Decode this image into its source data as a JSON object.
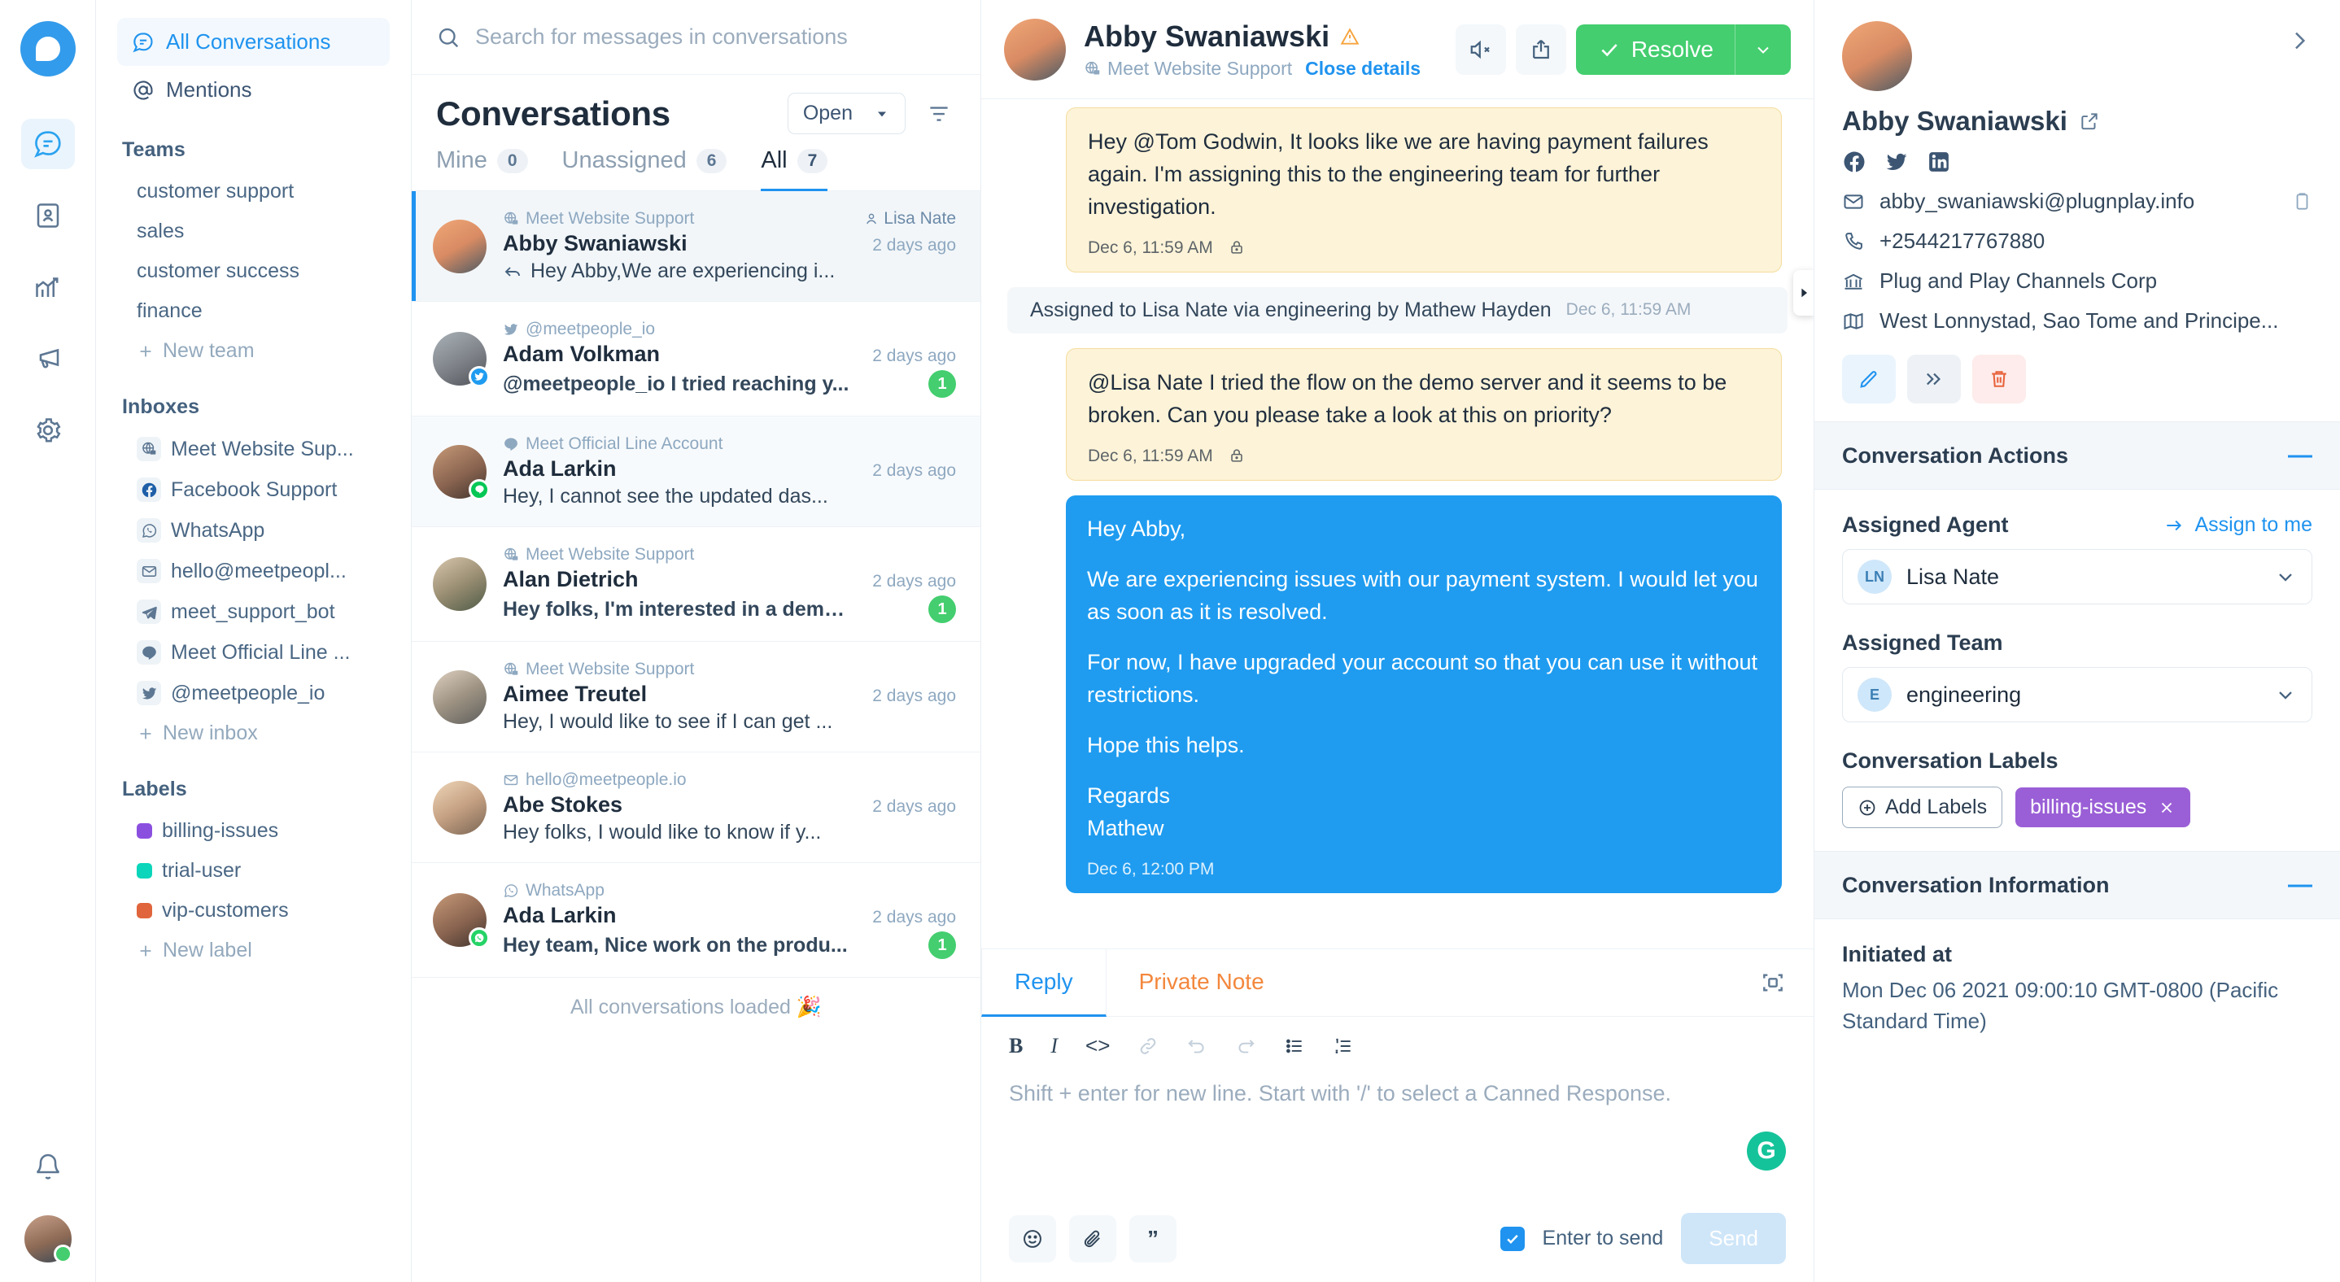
{
  "rail": {
    "logo_name": "chatwoot-logo",
    "items": [
      {
        "name": "conversations",
        "icon": "chat-icon",
        "active": true
      },
      {
        "name": "contacts",
        "icon": "contact-book-icon",
        "active": false
      },
      {
        "name": "reports",
        "icon": "chart-growth-icon",
        "active": false
      },
      {
        "name": "campaigns",
        "icon": "megaphone-icon",
        "active": false
      },
      {
        "name": "settings",
        "icon": "gear-icon",
        "active": false
      }
    ],
    "bottom": [
      {
        "name": "notifications",
        "icon": "bell-icon"
      },
      {
        "name": "profile-avatar",
        "icon": "avatar"
      }
    ]
  },
  "sidebar": {
    "primary": [
      {
        "label": "All Conversations",
        "icon": "chat-icon",
        "active": true
      },
      {
        "label": "Mentions",
        "icon": "at-icon",
        "active": false
      }
    ],
    "teams_heading": "Teams",
    "teams": [
      {
        "label": "customer support"
      },
      {
        "label": "sales"
      },
      {
        "label": "customer success"
      },
      {
        "label": "finance"
      }
    ],
    "new_team_label": "New team",
    "inboxes_heading": "Inboxes",
    "inboxes": [
      {
        "label": "Meet Website Sup...",
        "icon": "globe-website-icon",
        "color": "#5d7793"
      },
      {
        "label": "Facebook Support",
        "icon": "facebook-icon",
        "color": "#1f5fa8"
      },
      {
        "label": "WhatsApp",
        "icon": "whatsapp-icon",
        "color": "#3c5573"
      },
      {
        "label": "hello@meetpeopl...",
        "icon": "email-icon",
        "color": "#3c5573"
      },
      {
        "label": "meet_support_bot",
        "icon": "telegram-icon",
        "color": "#3c5573"
      },
      {
        "label": "Meet Official Line ...",
        "icon": "line-icon",
        "color": "#3c5573"
      },
      {
        "label": "@meetpeople_io",
        "icon": "twitter-icon",
        "color": "#3c5573"
      }
    ],
    "new_inbox_label": "New inbox",
    "labels_heading": "Labels",
    "labels": [
      {
        "label": "billing-issues",
        "color": "#8b4fe0"
      },
      {
        "label": "trial-user",
        "color": "#0bd5ba"
      },
      {
        "label": "vip-customers",
        "color": "#e0653c"
      }
    ],
    "new_label_label": "New label"
  },
  "search": {
    "placeholder": "Search for messages in conversations",
    "value": ""
  },
  "conversations_panel": {
    "title": "Conversations",
    "status_filter": "Open",
    "tabs": [
      {
        "label": "Mine",
        "count": "0",
        "active": false
      },
      {
        "label": "Unassigned",
        "count": "6",
        "active": false
      },
      {
        "label": "All",
        "count": "7",
        "active": true
      }
    ],
    "items": [
      {
        "source": "Meet Website Support",
        "source_icon": "globe-website-icon",
        "name": "Abby Swaniawski",
        "time": "2 days ago",
        "preview": "Hey Abby,We are experiencing i...",
        "preview_icon": "reply-arrow-icon",
        "assignee": "Lisa Nate",
        "unread": "",
        "active": true,
        "avatar_from": "#f0a878",
        "avatar_to": "#4a5a64",
        "channel_badge": ""
      },
      {
        "source": "@meetpeople_io",
        "source_icon": "twitter-icon",
        "name": "Adam Volkman",
        "time": "2 days ago",
        "preview": "@meetpeople_io I tried reaching y...",
        "preview_icon": "",
        "assignee": "",
        "unread": "1",
        "active": false,
        "avatar_from": "#9da6ad",
        "avatar_to": "#5c5f63",
        "channel_badge": "twitter"
      },
      {
        "source": "Meet Official Line Account",
        "source_icon": "line-icon",
        "name": "Ada Larkin",
        "time": "2 days ago",
        "preview": "Hey, I cannot see the updated das...",
        "preview_icon": "",
        "assignee": "",
        "unread": "",
        "active": false,
        "alt": true,
        "avatar_from": "#b98a6b",
        "avatar_to": "#4b3b33",
        "channel_badge": "line"
      },
      {
        "source": "Meet Website Support",
        "source_icon": "globe-website-icon",
        "name": "Alan Dietrich",
        "time": "2 days ago",
        "preview": "Hey folks, I'm interested in a demo...",
        "preview_icon": "",
        "assignee": "",
        "unread": "1",
        "active": false,
        "bold": true,
        "avatar_from": "#c9b9a4",
        "avatar_to": "#5d6b58",
        "channel_badge": ""
      },
      {
        "source": "Meet Website Support",
        "source_icon": "globe-website-icon",
        "name": "Aimee Treutel",
        "time": "2 days ago",
        "preview": "Hey, I would like to see if I can get ...",
        "preview_icon": "",
        "assignee": "",
        "unread": "",
        "active": false,
        "avatar_from": "#cdbba9",
        "avatar_to": "#6a6a68",
        "channel_badge": ""
      },
      {
        "source": "hello@meetpeople.io",
        "source_icon": "email-icon",
        "name": "Abe Stokes",
        "time": "2 days ago",
        "preview": "Hey folks, I would like to know if y...",
        "preview_icon": "",
        "assignee": "",
        "unread": "",
        "active": false,
        "avatar_from": "#e3c3a4",
        "avatar_to": "#7d6a58",
        "channel_badge": ""
      },
      {
        "source": "WhatsApp",
        "source_icon": "whatsapp-icon",
        "name": "Ada Larkin",
        "time": "2 days ago",
        "preview": "Hey team, Nice work on the produ...",
        "preview_icon": "",
        "assignee": "",
        "unread": "1",
        "active": false,
        "bold": true,
        "avatar_from": "#b98a6b",
        "avatar_to": "#4b3b33",
        "channel_badge": "whatsapp"
      }
    ],
    "footer": "All conversations loaded 🎉"
  },
  "conversation_header": {
    "name": "Abby Swaniawski",
    "warning_icon": "warning-triangle-icon",
    "inbox": "Meet Website Support",
    "close_details_label": "Close details",
    "mute_icon": "mute-speaker-icon",
    "share_icon": "share-icon",
    "resolve_label": "Resolve"
  },
  "thread": {
    "messages": [
      {
        "type": "note",
        "mention": "@Tom Godwin",
        "prefix": "Hey ",
        "text": ", It looks like we are having payment failures again. I'm assigning this to the engineering team for further investigation.",
        "time": "Dec 6, 11:59 AM",
        "lock_icon": "lock-icon"
      },
      {
        "type": "system",
        "text": "Assigned to Lisa Nate via engineering by Mathew Hayden",
        "time": "Dec 6, 11:59 AM"
      },
      {
        "type": "note",
        "mention": "@Lisa Nate",
        "prefix": "",
        "text": " I tried the flow on the demo server and it seems to be broken. Can you please take a look at this on priority?",
        "time": "Dec 6, 11:59 AM",
        "lock_icon": "lock-icon"
      },
      {
        "type": "outgoing",
        "paragraphs": [
          "Hey Abby,",
          "We are experiencing issues with our payment system. I would let you as soon as it is resolved.",
          "For now, I have upgraded your account so that you can use it without restrictions.",
          "Hope this helps.",
          "Regards",
          "Mathew"
        ],
        "time": "Dec 6, 12:00 PM"
      }
    ]
  },
  "editor": {
    "tabs": [
      {
        "label": "Reply",
        "active": true
      },
      {
        "label": "Private Note",
        "active": false
      }
    ],
    "expand_icon": "expand-icon",
    "toolbar": [
      {
        "name": "bold",
        "glyph": "B"
      },
      {
        "name": "italic",
        "glyph": "I"
      },
      {
        "name": "code",
        "glyph": "<>"
      },
      {
        "name": "link",
        "glyph": "🔗"
      },
      {
        "name": "undo",
        "glyph": "↩"
      },
      {
        "name": "redo",
        "glyph": "↪"
      },
      {
        "name": "bullet-list",
        "glyph": "☰"
      },
      {
        "name": "numbered-list",
        "glyph": "≣"
      }
    ],
    "placeholder": "Shift + enter for new line. Start with '/' to select a Canned Response.",
    "grammarly_glyph": "G",
    "emoji_icon": "emoji-icon",
    "attachment_icon": "paperclip-icon",
    "canned_icon": "quote-icon",
    "enter_to_send_label": "Enter to send",
    "enter_to_send_checked": true,
    "send_label": "Send"
  },
  "contact_panel": {
    "collapse_icon": "chevron-right-icon",
    "name": "Abby Swaniawski",
    "external_link_icon": "external-link-icon",
    "social": [
      {
        "name": "facebook-icon"
      },
      {
        "name": "twitter-icon"
      },
      {
        "name": "linkedin-icon"
      }
    ],
    "email": "abby_swaniawski@plugnplay.info",
    "copy_icon": "clipboard-copy-icon",
    "phone": "+2544217767880",
    "company": "Plug and Play Channels Corp",
    "location": "West Lonnystad, Sao Tome and Principe...",
    "actions": [
      {
        "name": "edit-contact",
        "icon": "pencil-icon"
      },
      {
        "name": "merge-contact",
        "icon": "merge-arrows-icon"
      },
      {
        "name": "delete-contact",
        "icon": "trash-icon"
      }
    ],
    "conversation_actions": {
      "heading": "Conversation Actions",
      "collapse_glyph": "—",
      "assigned_agent_label": "Assigned Agent",
      "assign_to_me_label": "Assign to me",
      "agent_value": "Lisa Nate",
      "agent_initials": "LN",
      "assigned_team_label": "Assigned Team",
      "team_value": "engineering",
      "team_initials": "E",
      "labels_heading": "Conversation Labels",
      "add_labels_label": "Add Labels",
      "applied_labels": [
        {
          "label": "billing-issues",
          "color": "#9a5fd6"
        }
      ]
    },
    "conversation_information": {
      "heading": "Conversation Information",
      "collapse_glyph": "—",
      "initiated_at_label": "Initiated at",
      "initiated_at_value": "Mon Dec 06 2021 09:00:10 GMT-0800 (Pacific Standard Time)"
    }
  }
}
